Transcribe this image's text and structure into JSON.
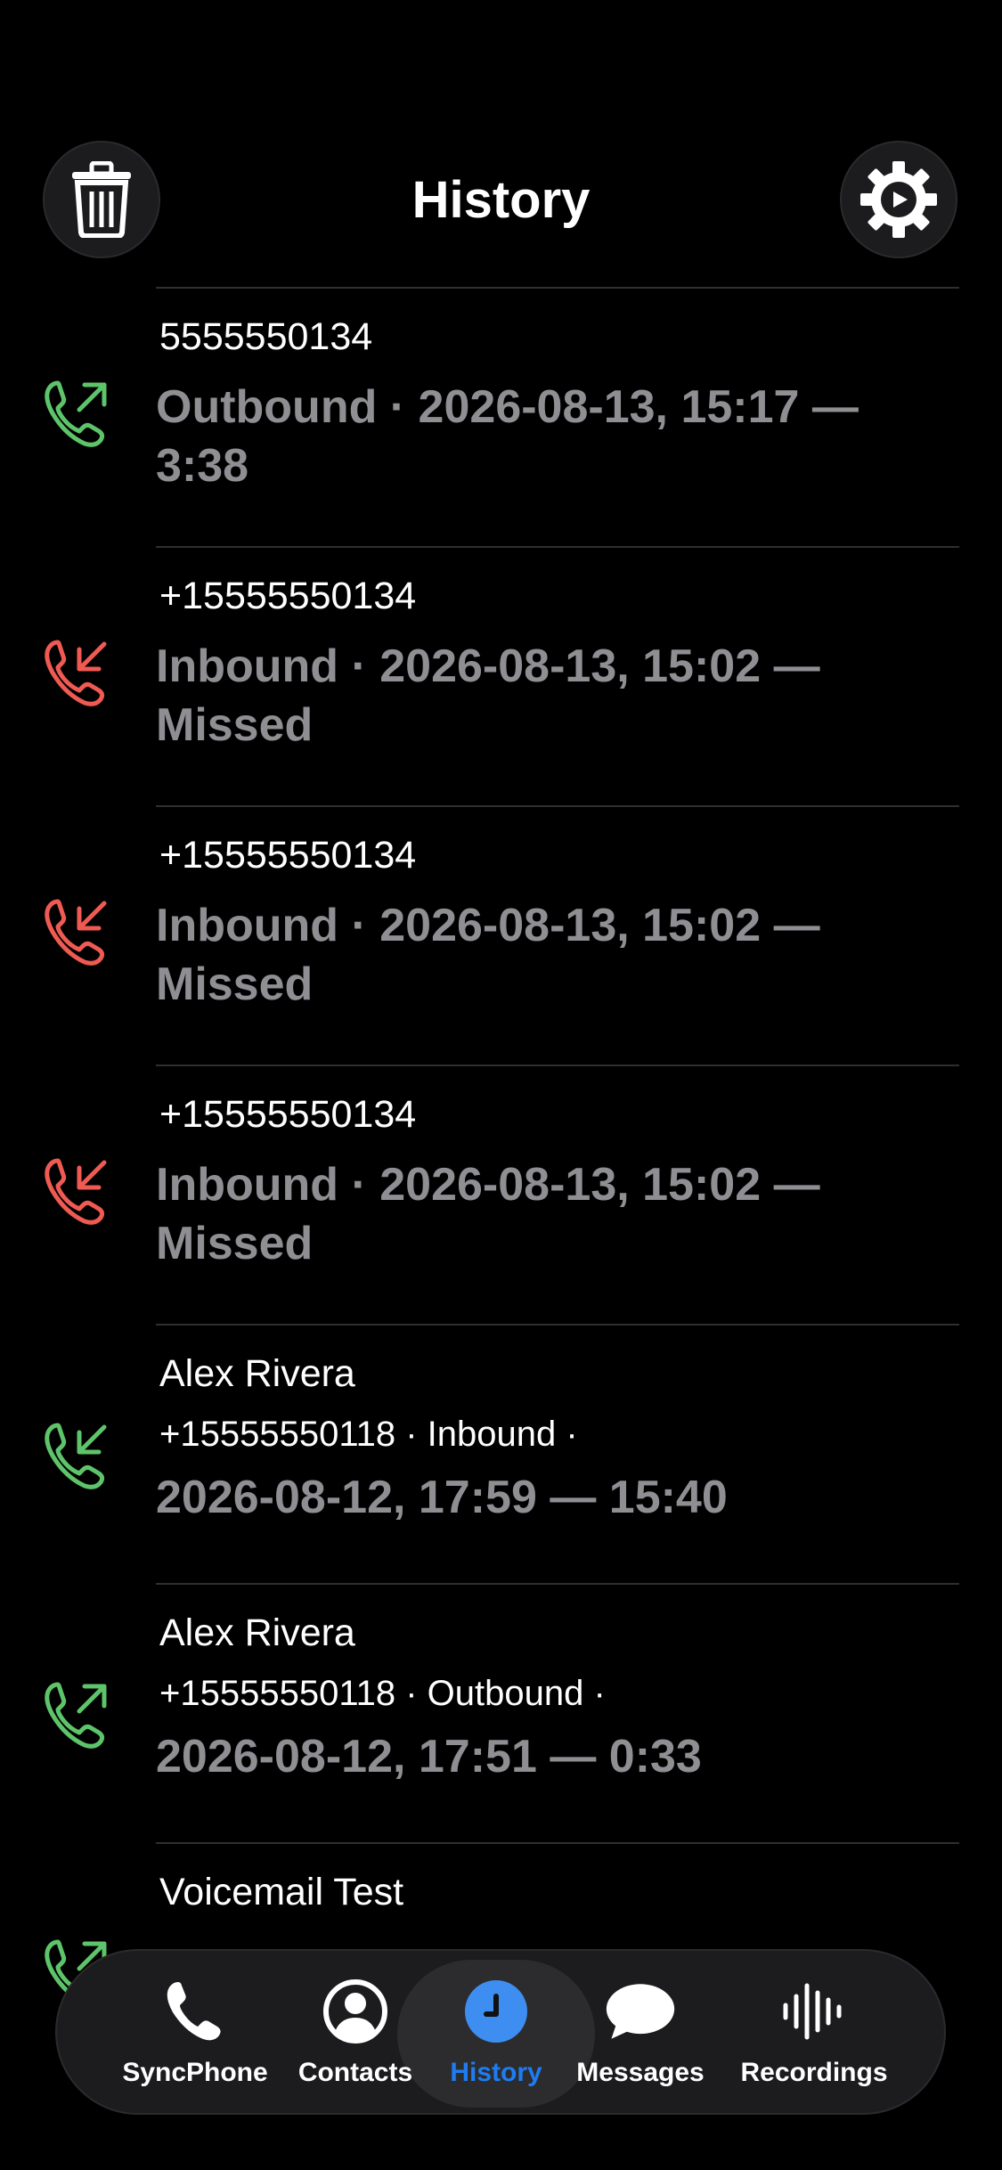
{
  "header": {
    "title": "History",
    "delete_icon": "trash-icon",
    "settings_icon": "gear-icon"
  },
  "colors": {
    "outbound": "#5ec46a",
    "missed": "#ef5a52",
    "accent": "#1e7cf2"
  },
  "calls": [
    {
      "name": "5555550134",
      "detail": "Outbound · 2026-08-13, 15:17 — 3:38",
      "direction": "outbound",
      "status": "ok"
    },
    {
      "name": "+15555550134",
      "detail": "Inbound · 2026-08-13, 15:02 — Missed",
      "direction": "inbound",
      "status": "missed"
    },
    {
      "name": "+15555550134",
      "detail": "Inbound · 2026-08-13, 15:02 — Missed",
      "direction": "inbound",
      "status": "missed"
    },
    {
      "name": "+15555550134",
      "detail": "Inbound · 2026-08-13, 15:02 — Missed",
      "direction": "inbound",
      "status": "missed"
    },
    {
      "name": "Alex Rivera",
      "number_line": "+15555550118 · Inbound ·",
      "detail": "2026-08-12, 17:59 — 15:40",
      "direction": "inbound",
      "status": "ok"
    },
    {
      "name": "Alex Rivera",
      "number_line": "+15555550118 · Outbound ·",
      "detail": "2026-08-12, 17:51 — 0:33",
      "direction": "outbound",
      "status": "ok"
    },
    {
      "name": "Voicemail Test",
      "direction": "outbound",
      "status": "ok"
    }
  ],
  "tabs": [
    {
      "label": "SyncPhone",
      "icon": "phone-icon"
    },
    {
      "label": "Contacts",
      "icon": "person-icon"
    },
    {
      "label": "History",
      "icon": "clock-icon",
      "active": true
    },
    {
      "label": "Messages",
      "icon": "message-bubble-icon"
    },
    {
      "label": "Recordings",
      "icon": "waveform-icon"
    }
  ]
}
